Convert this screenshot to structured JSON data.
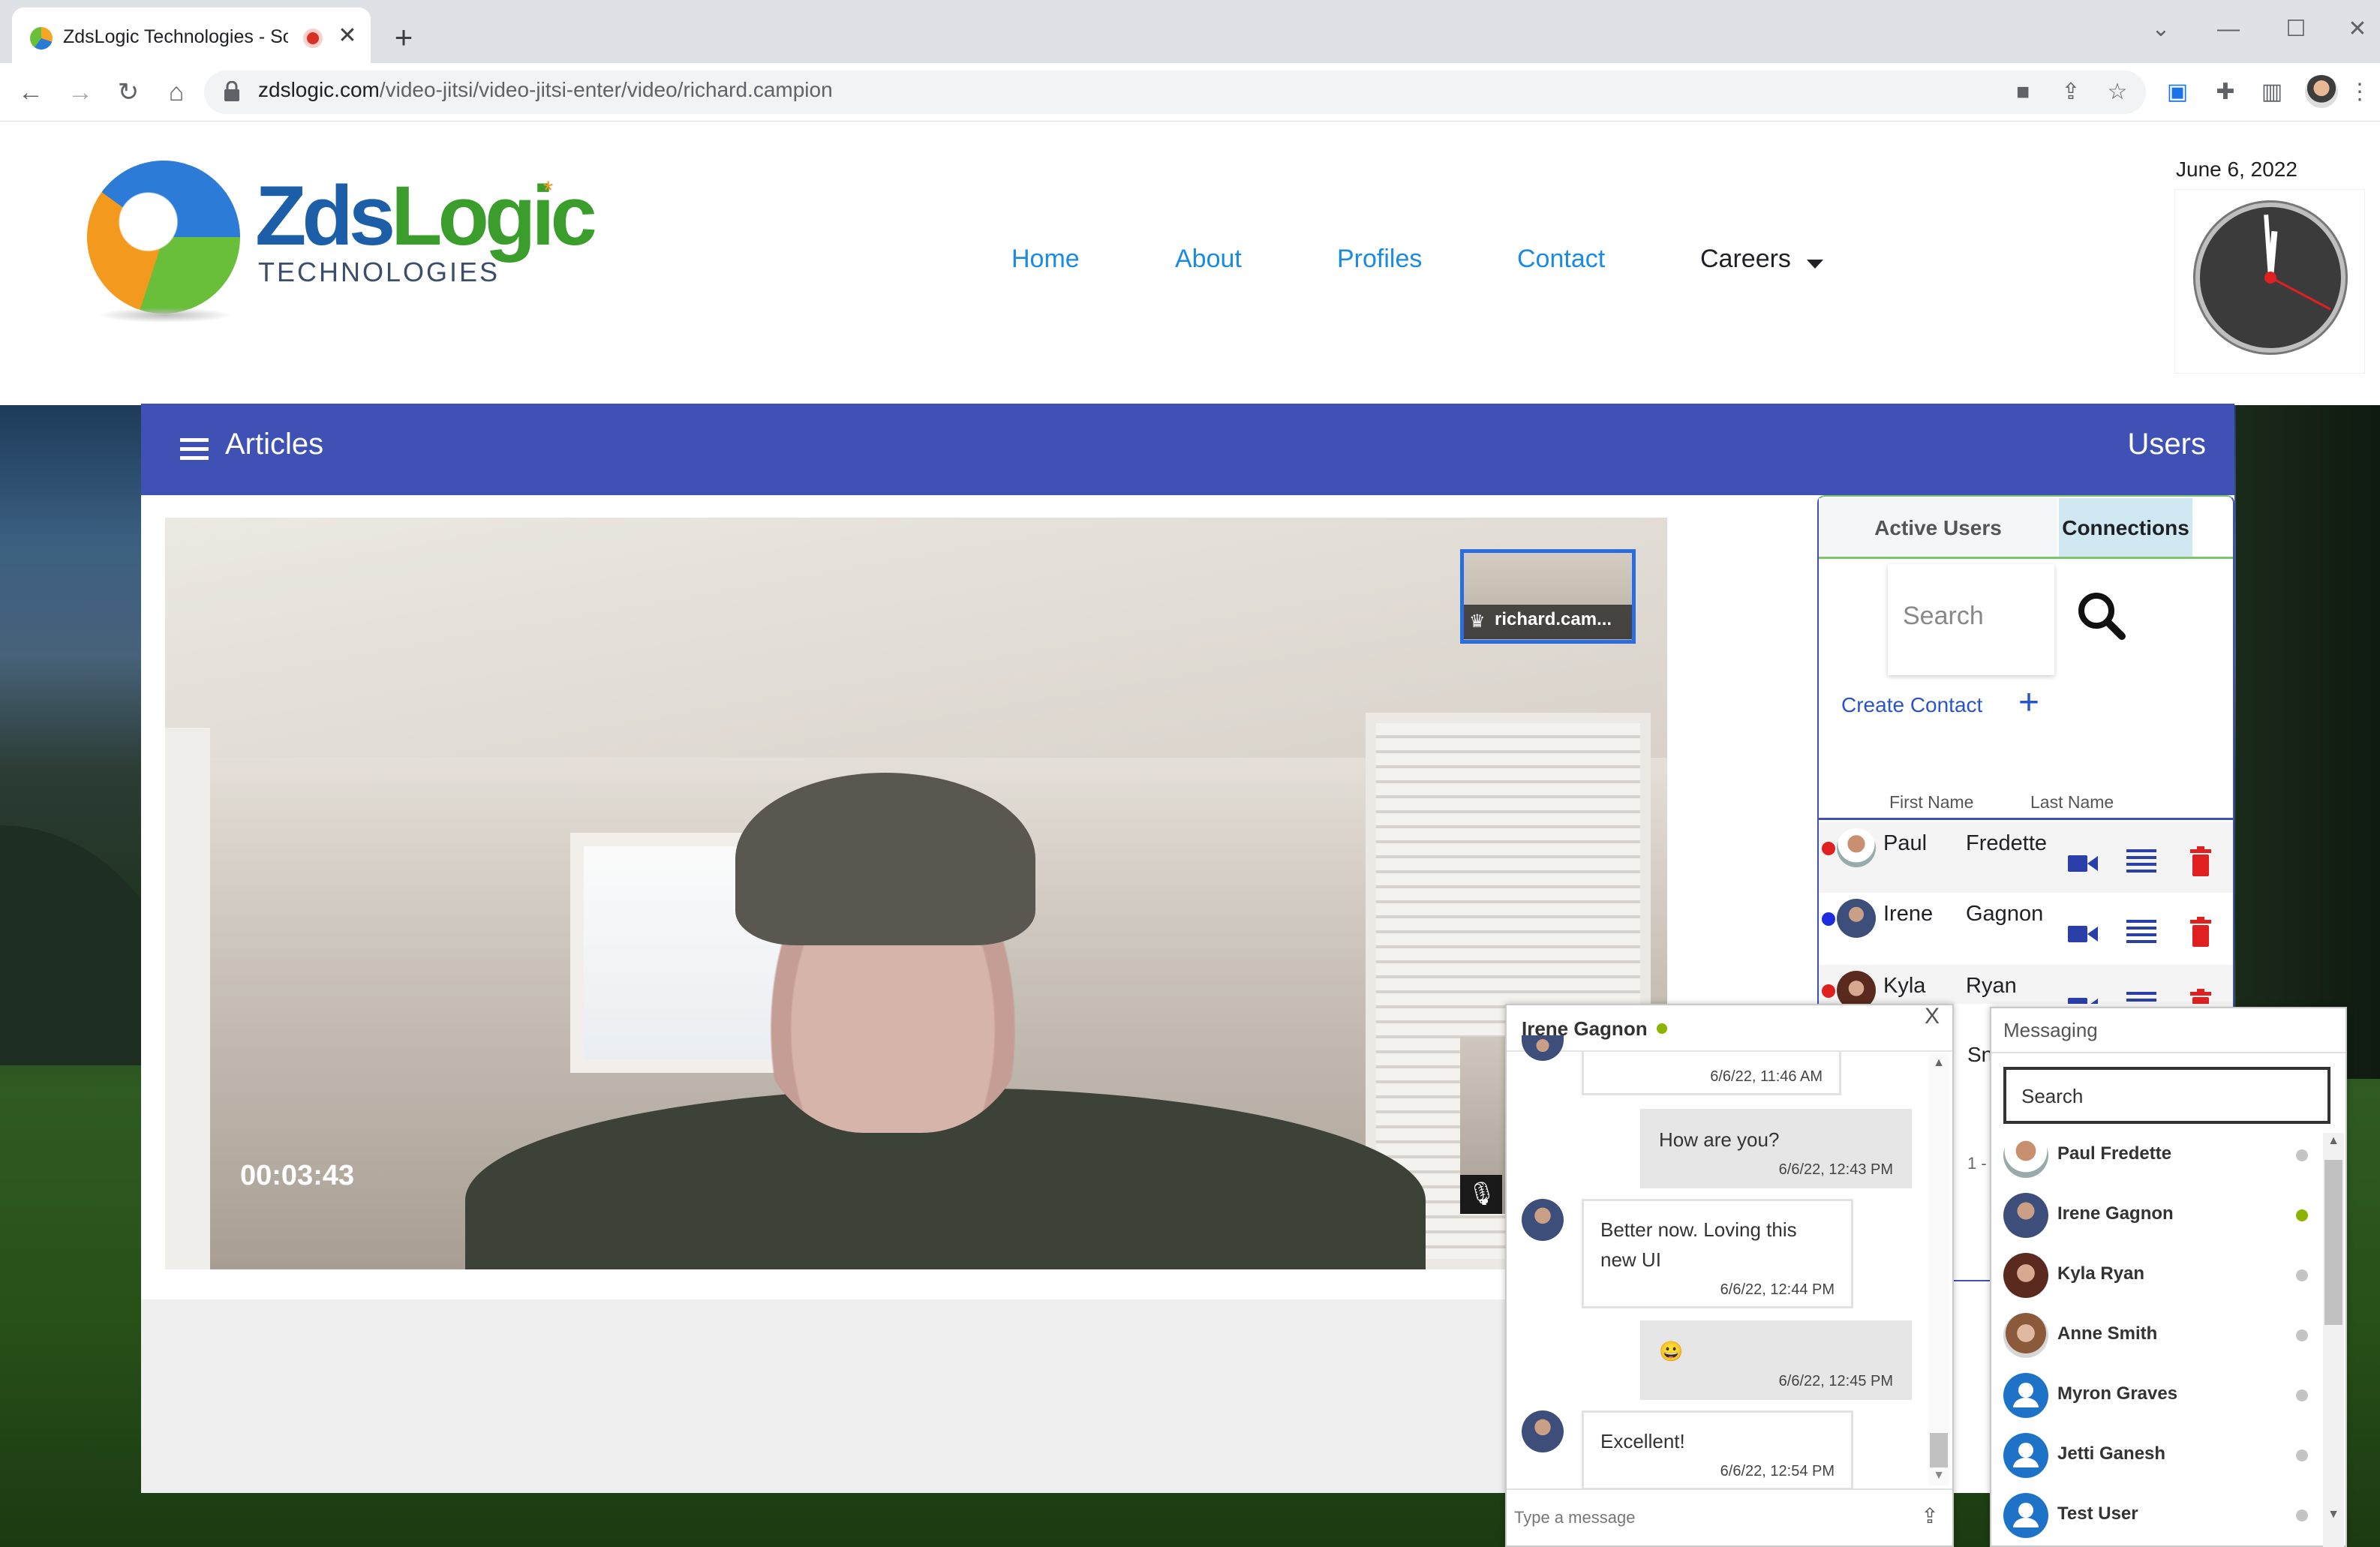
{
  "browser": {
    "tab_title": "ZdsLogic Technologies - Soft",
    "new_tab": "+",
    "tab_close": "✕",
    "url_host": "zdslogic.com",
    "url_path": "/video-jitsi/video-jitsi-enter/video/richard.campion",
    "icons": [
      "back-icon",
      "forward-icon",
      "reload-icon",
      "home-icon",
      "camera-icon",
      "share-icon",
      "star-icon",
      "extension-icon",
      "puzzle-icon",
      "sidepanel-icon",
      "kebab-icon"
    ]
  },
  "site": {
    "logo_main_1": "Zds",
    "logo_main_2": "Logic",
    "logo_sub": "TECHNOLOGIES",
    "nav": {
      "home": "Home",
      "about": "About",
      "profiles": "Profiles",
      "contact": "Contact",
      "careers": "Careers"
    },
    "date": "June 6, 2022",
    "accent": "#1a8be0"
  },
  "articles_bar": {
    "title": "Articles",
    "users": "Users",
    "color": "#3f51b5"
  },
  "video": {
    "timer": "00:03:43",
    "participant": "richard.cam..."
  },
  "users_panel": {
    "tab_active": "Active Users",
    "tab_connections": "Connections",
    "search_placeholder": "Search",
    "create_contact": "Create Contact",
    "col_first": "First Name",
    "col_last": "Last Name",
    "rows": [
      {
        "first": "Paul",
        "last": "Fredette",
        "status_color": "#e02020"
      },
      {
        "first": "Irene",
        "last": "Gagnon",
        "status_color": "#1d2ce0"
      },
      {
        "first": "Kyla",
        "last": "Ryan",
        "status_color": "#e02020"
      }
    ],
    "behind_text_1": "Sn",
    "behind_text_2": "1 -"
  },
  "chat": {
    "title": "Irene Gagnon",
    "close": "X",
    "messages": [
      {
        "text": "",
        "time": "6/6/22, 11:46 AM",
        "dir": "in"
      },
      {
        "text": "How are you?",
        "time": "6/6/22, 12:43 PM",
        "dir": "out"
      },
      {
        "text": "Better now. Loving this new UI",
        "time": "6/6/22, 12:44 PM",
        "dir": "in"
      },
      {
        "text": "😀",
        "time": "6/6/22, 12:45 PM",
        "dir": "out"
      },
      {
        "text": "Excellent!",
        "time": "6/6/22, 12:54 PM",
        "dir": "in"
      }
    ],
    "input_placeholder": "Type a message"
  },
  "messaging": {
    "title": "Messaging",
    "search_placeholder": "Search",
    "contacts": [
      {
        "name": "Paul Fredette",
        "online": false
      },
      {
        "name": "Irene Gagnon",
        "online": true
      },
      {
        "name": "Kyla Ryan",
        "online": false
      },
      {
        "name": "Anne Smith",
        "online": false
      },
      {
        "name": "Myron Graves",
        "online": false
      },
      {
        "name": "Jetti Ganesh",
        "online": false
      },
      {
        "name": "Test User",
        "online": false
      }
    ],
    "online_color": "#8bb300"
  }
}
